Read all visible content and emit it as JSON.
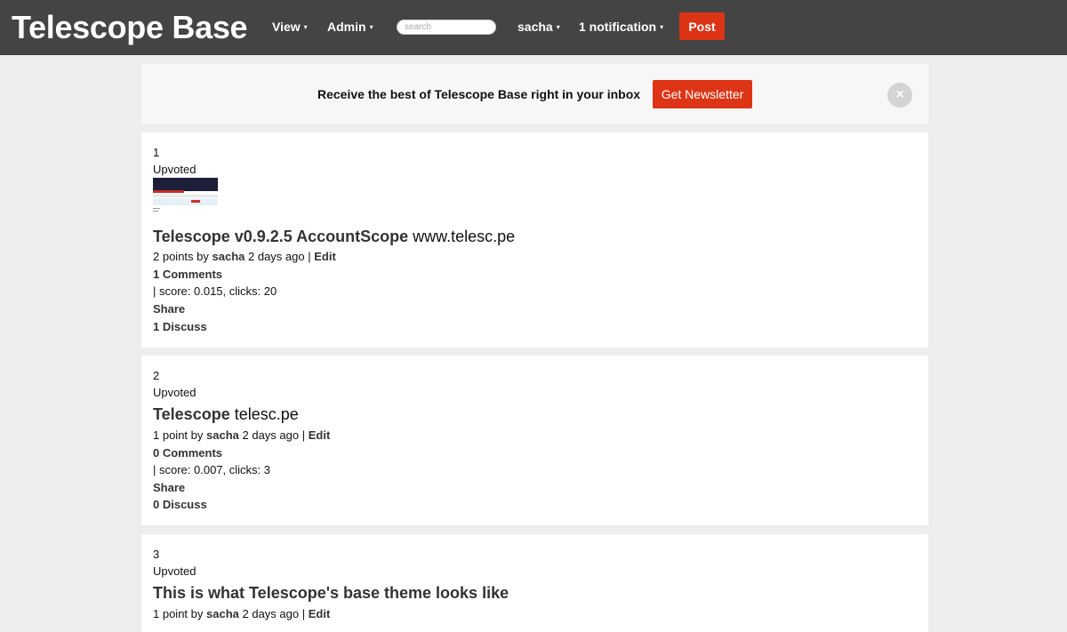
{
  "header": {
    "logo": "Telescope Base",
    "nav": {
      "view": "View",
      "admin": "Admin",
      "user": "sacha",
      "notifications": "1 notification"
    },
    "caret": "▾",
    "search_placeholder": "search",
    "post_button": "Post"
  },
  "newsletter": {
    "text": "Receive the best of Telescope Base right in your inbox",
    "button": "Get Newsletter",
    "close_icon": "×"
  },
  "posts": [
    {
      "rank": "1",
      "vote_status": "Upvoted",
      "has_thumbnail": true,
      "title": "Telescope v0.9.2.5 AccountScope",
      "domain": "www.telesc.pe",
      "points": "2 points by",
      "author": "sacha",
      "age": "2 days ago",
      "separator": "|",
      "edit": "Edit",
      "comments": "1 Comments",
      "stats": "| score: 0.015, clicks: 20",
      "share": "Share",
      "discuss": "1 Discuss"
    },
    {
      "rank": "2",
      "vote_status": "Upvoted",
      "has_thumbnail": false,
      "title": "Telescope",
      "domain": "telesc.pe",
      "points": "1 point by",
      "author": "sacha",
      "age": "2 days ago",
      "separator": "|",
      "edit": "Edit",
      "comments": "0 Comments",
      "stats": "| score: 0.007, clicks: 3",
      "share": "Share",
      "discuss": "0 Discuss"
    },
    {
      "rank": "3",
      "vote_status": "Upvoted",
      "has_thumbnail": false,
      "title": "This is what Telescope's base theme looks like",
      "domain": "",
      "points": "1 point by",
      "author": "sacha",
      "age": "2 days ago",
      "separator": "|",
      "edit": "Edit"
    }
  ],
  "colors": {
    "header_bg": "#444444",
    "accent": "#dd3416",
    "page_bg": "#ededed",
    "card_bg": "#ffffff",
    "newsletter_bg": "#f7f7f7"
  }
}
